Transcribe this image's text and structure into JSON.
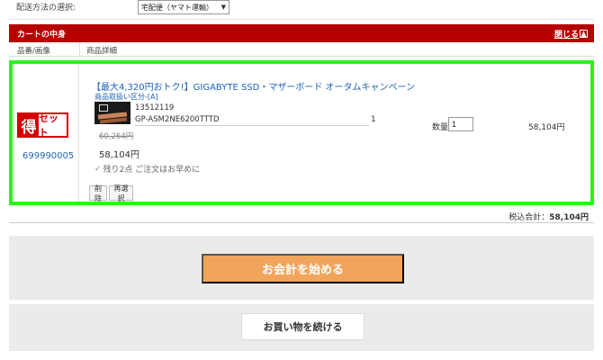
{
  "shipping": {
    "label": "配送方法の選択:",
    "selected": "宅配便（ヤマト運輸）",
    "caret": "▼"
  },
  "cart_header": {
    "title": "カートの中身",
    "close_label": "閉じる",
    "close_icon": "▲"
  },
  "columns": {
    "image": "品番/画像",
    "detail": "商品詳細"
  },
  "item": {
    "badge_left": "得",
    "badge_right": "セット",
    "code": "699990005",
    "title": "【最大4,320円おトク!】GIGABYTE SSD・マザーボード オータムキャンペーン",
    "subtitle": "商品取扱い区分-[A]",
    "sku": "13512119",
    "model": "GP-ASM2NE6200TTTD",
    "sub_qty": "1",
    "qty_label": "数量",
    "qty_value": "1",
    "line_total": "58,104円",
    "old_price": "60,264円",
    "price": "58,104円",
    "stock_icon": "✓",
    "stock_note": "残り2点 ご注文はお早めに",
    "delete_label": "削除",
    "reselect_label": "再選択"
  },
  "totals": {
    "label": "税込合計：",
    "value": "58,104円"
  },
  "actions": {
    "checkout": "お会計を始める",
    "continue": "お買い物を続ける"
  },
  "colors": {
    "header_red": "#b60000",
    "highlight_green": "#2ef21e",
    "checkout_orange": "#f0a55b",
    "link_blue": "#2064b8"
  }
}
